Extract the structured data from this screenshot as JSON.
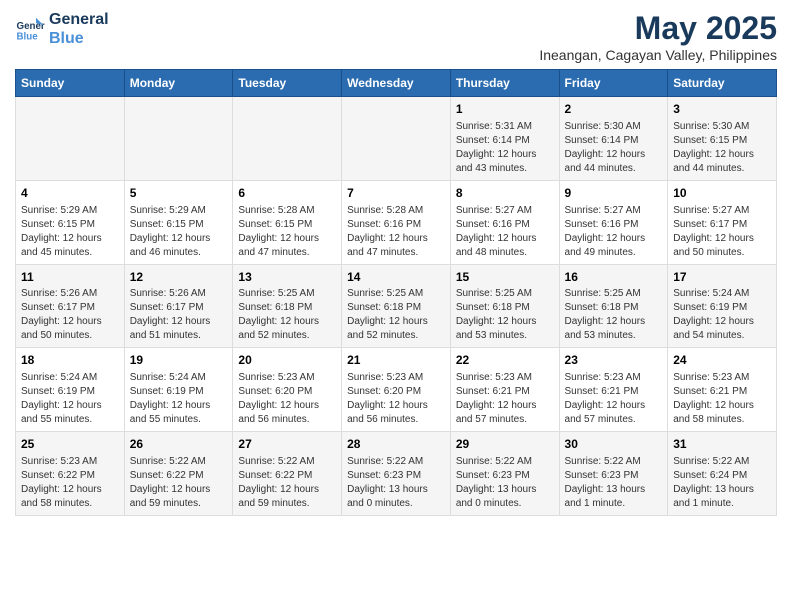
{
  "logo": {
    "line1": "General",
    "line2": "Blue"
  },
  "title": "May 2025",
  "subtitle": "Ineangan, Cagayan Valley, Philippines",
  "days_of_week": [
    "Sunday",
    "Monday",
    "Tuesday",
    "Wednesday",
    "Thursday",
    "Friday",
    "Saturday"
  ],
  "weeks": [
    [
      {
        "day": "",
        "info": ""
      },
      {
        "day": "",
        "info": ""
      },
      {
        "day": "",
        "info": ""
      },
      {
        "day": "",
        "info": ""
      },
      {
        "day": "1",
        "info": "Sunrise: 5:31 AM\nSunset: 6:14 PM\nDaylight: 12 hours\nand 43 minutes."
      },
      {
        "day": "2",
        "info": "Sunrise: 5:30 AM\nSunset: 6:14 PM\nDaylight: 12 hours\nand 44 minutes."
      },
      {
        "day": "3",
        "info": "Sunrise: 5:30 AM\nSunset: 6:15 PM\nDaylight: 12 hours\nand 44 minutes."
      }
    ],
    [
      {
        "day": "4",
        "info": "Sunrise: 5:29 AM\nSunset: 6:15 PM\nDaylight: 12 hours\nand 45 minutes."
      },
      {
        "day": "5",
        "info": "Sunrise: 5:29 AM\nSunset: 6:15 PM\nDaylight: 12 hours\nand 46 minutes."
      },
      {
        "day": "6",
        "info": "Sunrise: 5:28 AM\nSunset: 6:15 PM\nDaylight: 12 hours\nand 47 minutes."
      },
      {
        "day": "7",
        "info": "Sunrise: 5:28 AM\nSunset: 6:16 PM\nDaylight: 12 hours\nand 47 minutes."
      },
      {
        "day": "8",
        "info": "Sunrise: 5:27 AM\nSunset: 6:16 PM\nDaylight: 12 hours\nand 48 minutes."
      },
      {
        "day": "9",
        "info": "Sunrise: 5:27 AM\nSunset: 6:16 PM\nDaylight: 12 hours\nand 49 minutes."
      },
      {
        "day": "10",
        "info": "Sunrise: 5:27 AM\nSunset: 6:17 PM\nDaylight: 12 hours\nand 50 minutes."
      }
    ],
    [
      {
        "day": "11",
        "info": "Sunrise: 5:26 AM\nSunset: 6:17 PM\nDaylight: 12 hours\nand 50 minutes."
      },
      {
        "day": "12",
        "info": "Sunrise: 5:26 AM\nSunset: 6:17 PM\nDaylight: 12 hours\nand 51 minutes."
      },
      {
        "day": "13",
        "info": "Sunrise: 5:25 AM\nSunset: 6:18 PM\nDaylight: 12 hours\nand 52 minutes."
      },
      {
        "day": "14",
        "info": "Sunrise: 5:25 AM\nSunset: 6:18 PM\nDaylight: 12 hours\nand 52 minutes."
      },
      {
        "day": "15",
        "info": "Sunrise: 5:25 AM\nSunset: 6:18 PM\nDaylight: 12 hours\nand 53 minutes."
      },
      {
        "day": "16",
        "info": "Sunrise: 5:25 AM\nSunset: 6:18 PM\nDaylight: 12 hours\nand 53 minutes."
      },
      {
        "day": "17",
        "info": "Sunrise: 5:24 AM\nSunset: 6:19 PM\nDaylight: 12 hours\nand 54 minutes."
      }
    ],
    [
      {
        "day": "18",
        "info": "Sunrise: 5:24 AM\nSunset: 6:19 PM\nDaylight: 12 hours\nand 55 minutes."
      },
      {
        "day": "19",
        "info": "Sunrise: 5:24 AM\nSunset: 6:19 PM\nDaylight: 12 hours\nand 55 minutes."
      },
      {
        "day": "20",
        "info": "Sunrise: 5:23 AM\nSunset: 6:20 PM\nDaylight: 12 hours\nand 56 minutes."
      },
      {
        "day": "21",
        "info": "Sunrise: 5:23 AM\nSunset: 6:20 PM\nDaylight: 12 hours\nand 56 minutes."
      },
      {
        "day": "22",
        "info": "Sunrise: 5:23 AM\nSunset: 6:21 PM\nDaylight: 12 hours\nand 57 minutes."
      },
      {
        "day": "23",
        "info": "Sunrise: 5:23 AM\nSunset: 6:21 PM\nDaylight: 12 hours\nand 57 minutes."
      },
      {
        "day": "24",
        "info": "Sunrise: 5:23 AM\nSunset: 6:21 PM\nDaylight: 12 hours\nand 58 minutes."
      }
    ],
    [
      {
        "day": "25",
        "info": "Sunrise: 5:23 AM\nSunset: 6:22 PM\nDaylight: 12 hours\nand 58 minutes."
      },
      {
        "day": "26",
        "info": "Sunrise: 5:22 AM\nSunset: 6:22 PM\nDaylight: 12 hours\nand 59 minutes."
      },
      {
        "day": "27",
        "info": "Sunrise: 5:22 AM\nSunset: 6:22 PM\nDaylight: 12 hours\nand 59 minutes."
      },
      {
        "day": "28",
        "info": "Sunrise: 5:22 AM\nSunset: 6:23 PM\nDaylight: 13 hours\nand 0 minutes."
      },
      {
        "day": "29",
        "info": "Sunrise: 5:22 AM\nSunset: 6:23 PM\nDaylight: 13 hours\nand 0 minutes."
      },
      {
        "day": "30",
        "info": "Sunrise: 5:22 AM\nSunset: 6:23 PM\nDaylight: 13 hours\nand 1 minute."
      },
      {
        "day": "31",
        "info": "Sunrise: 5:22 AM\nSunset: 6:24 PM\nDaylight: 13 hours\nand 1 minute."
      }
    ]
  ]
}
